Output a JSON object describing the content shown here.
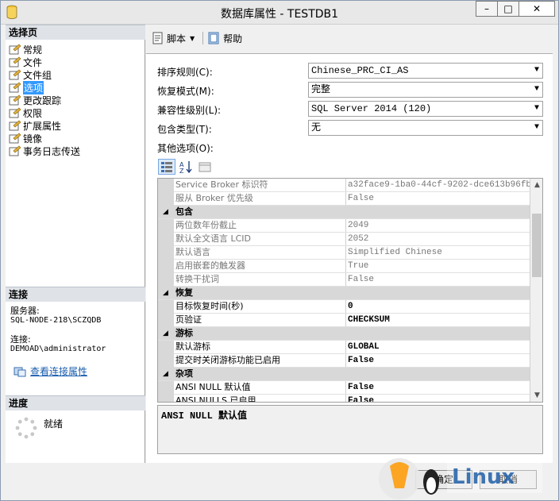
{
  "window": {
    "title": "数据库属性 - TESTDB1",
    "minimize": "–",
    "maximize": "□",
    "close": "✕"
  },
  "sidebar": {
    "pages_header": "选择页",
    "pages": [
      "常规",
      "文件",
      "文件组",
      "选项",
      "更改跟踪",
      "权限",
      "扩展属性",
      "镜像",
      "事务日志传送"
    ],
    "selected_index": 3,
    "connection_header": "连接",
    "server_label": "服务器:",
    "server_value": "SQL-NODE-218\\SCZQDB",
    "connection_label": "连接:",
    "connection_value": "DEMOAD\\administrator",
    "view_connection_link": "查看连接属性",
    "progress_header": "进度",
    "progress_status": "就绪"
  },
  "toolbar": {
    "script_label": "脚本",
    "help_label": "帮助"
  },
  "settings": {
    "collation_label": "排序规则(C):",
    "collation_value": "Chinese_PRC_CI_AS",
    "recovery_label": "恢复模式(M):",
    "recovery_value": "完整",
    "compat_label": "兼容性级别(L):",
    "compat_value": "SQL Server 2014 (120)",
    "containment_label": "包含类型(T):",
    "containment_value": "无",
    "other_options_label": "其他选项(O):"
  },
  "grid": {
    "rows": [
      {
        "type": "prop",
        "key": "Service Broker 标识符",
        "value": "a32face9-1ba0-44cf-9202-dce613b96fb3",
        "readonly": true
      },
      {
        "type": "prop",
        "key": "服从 Broker 优先级",
        "value": "False",
        "readonly": true
      },
      {
        "type": "cat",
        "key": "包含"
      },
      {
        "type": "prop",
        "key": "两位数年份截止",
        "value": "2049",
        "readonly": true
      },
      {
        "type": "prop",
        "key": "默认全文语言 LCID",
        "value": "2052",
        "readonly": true
      },
      {
        "type": "prop",
        "key": "默认语言",
        "value": "Simplified Chinese",
        "readonly": true
      },
      {
        "type": "prop",
        "key": "启用嵌套的触发器",
        "value": "True",
        "readonly": true
      },
      {
        "type": "prop",
        "key": "转换干扰词",
        "value": "False",
        "readonly": true
      },
      {
        "type": "cat",
        "key": "恢复"
      },
      {
        "type": "prop",
        "key": "目标恢复时间(秒)",
        "value": "0",
        "readonly": false
      },
      {
        "type": "prop",
        "key": "页验证",
        "value": "CHECKSUM",
        "readonly": false
      },
      {
        "type": "cat",
        "key": "游标"
      },
      {
        "type": "prop",
        "key": "默认游标",
        "value": "GLOBAL",
        "readonly": false
      },
      {
        "type": "prop",
        "key": "提交时关闭游标功能已启用",
        "value": "False",
        "readonly": false
      },
      {
        "type": "cat",
        "key": "杂项"
      },
      {
        "type": "prop",
        "key": "ANSI NULL 默认值",
        "value": "False",
        "readonly": false
      },
      {
        "type": "prop",
        "key": "ANSI NULLS 已启用",
        "value": "False",
        "readonly": false
      }
    ],
    "description": "ANSI NULL 默认值"
  },
  "footer": {
    "ok_label": "确定",
    "cancel_label": "取消"
  },
  "colors": {
    "selection": "#3399ff",
    "category_bg": "#d8d8d8",
    "link": "#1a5cad"
  }
}
